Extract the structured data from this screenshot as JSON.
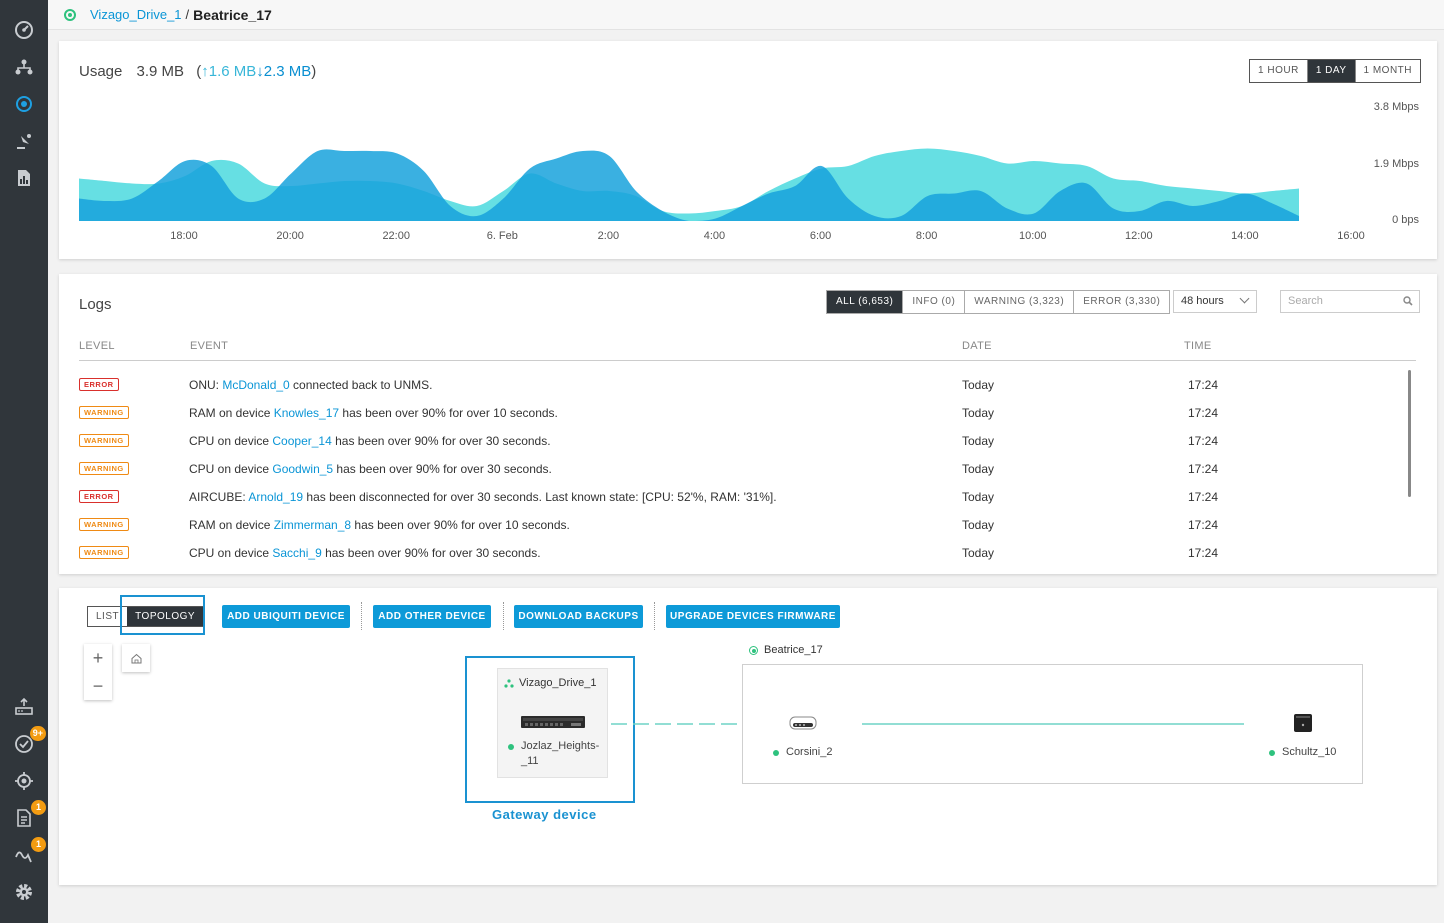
{
  "colors": {
    "accent": "#0a95d6",
    "sidebar": "#30363b",
    "online": "#2ec27e",
    "area_light": "#55dbe0",
    "area_dark": "#17a2dc"
  },
  "sidebar": {
    "icons": [
      "dashboard-icon",
      "sites-icon",
      "devices-icon",
      "wireless-icon",
      "reports-icon",
      "firmware-icon",
      "tasks-icon",
      "discovery-icon",
      "logs-icon",
      "outages-icon",
      "settings-icon"
    ],
    "badges": {
      "tasks": "9+",
      "logs": "1",
      "outages": "1"
    }
  },
  "breadcrumb": {
    "parent": "Vizago_Drive_1",
    "separator": "/",
    "current": "Beatrice_17"
  },
  "usage": {
    "title": "Usage",
    "total": "3.9 MB",
    "open_paren": "(",
    "upload": "1.6 MB",
    "download": "2.3 MB",
    "close_paren": ")",
    "ranges": [
      "1 HOUR",
      "1 DAY",
      "1 MONTH"
    ],
    "active_range": "1 DAY"
  },
  "chart_data": {
    "type": "area",
    "x": [
      "17:00",
      "17:30",
      "18:00",
      "18:30",
      "19:00",
      "19:30",
      "20:00",
      "20:30",
      "21:00",
      "21:30",
      "22:00",
      "22:30",
      "23:00",
      "23:30",
      "00:00",
      "00:30",
      "01:00",
      "01:30",
      "02:00",
      "02:30",
      "03:00",
      "03:30",
      "04:00",
      "04:30",
      "05:00",
      "05:30",
      "06:00",
      "06:30",
      "07:00",
      "07:30",
      "08:00",
      "08:30",
      "09:00",
      "09:30",
      "10:00",
      "10:30",
      "11:00",
      "11:30",
      "12:00",
      "12:30",
      "13:00",
      "13:30",
      "14:00",
      "14:30",
      "15:00",
      "15:30",
      "16:00"
    ],
    "xticks": [
      "18:00",
      "20:00",
      "22:00",
      "6. Feb",
      "2:00",
      "4:00",
      "6:00",
      "8:00",
      "10:00",
      "12:00",
      "14:00",
      "16:00"
    ],
    "yticks": [
      "3.8 Mbps",
      "1.9 Mbps",
      "0 bps"
    ],
    "ylim": [
      0,
      3.8
    ],
    "series": [
      {
        "values": [
          1.7,
          1.6,
          1.5,
          1.5,
          1.8,
          2.4,
          2.3,
          1.5,
          1.4,
          1.5,
          1.6,
          1.6,
          1.5,
          1.2,
          0.8,
          0.6,
          1.2,
          1.9,
          1.5,
          1.2,
          1.2,
          1.0,
          0.4,
          0.3,
          0.4,
          0.6,
          1.2,
          1.7,
          2.1,
          2.2,
          2.6,
          2.8,
          2.9,
          2.8,
          2.6,
          2.3,
          2.4,
          2.3,
          2.2,
          1.7,
          1.6,
          1.4,
          1.3,
          1.2,
          1.1,
          1.2,
          1.3
        ]
      },
      {
        "values": [
          0.9,
          0.8,
          0.9,
          1.6,
          2.4,
          2.2,
          0.9,
          0.9,
          1.9,
          2.8,
          2.8,
          2.8,
          2.7,
          2.0,
          0.6,
          0.2,
          0.9,
          2.1,
          2.5,
          2.8,
          2.6,
          1.2,
          0.4,
          0.0,
          0.1,
          0.6,
          1.1,
          1.4,
          2.2,
          0.9,
          0.2,
          0.2,
          1.0,
          1.1,
          1.2,
          0.5,
          0.3,
          1.2,
          1.5,
          0.5,
          0.4,
          0.8,
          0.6,
          0.8,
          1.1,
          0.7,
          0.2
        ]
      }
    ]
  },
  "logs": {
    "title": "Logs",
    "filters": [
      "ALL (6,653)",
      "INFO (0)",
      "WARNING (3,323)",
      "ERROR (3,330)"
    ],
    "active_filter": "ALL (6,653)",
    "period": "48 hours",
    "search_placeholder": "Search",
    "columns": {
      "level": "LEVEL",
      "event": "EVENT",
      "date": "DATE",
      "time": "TIME"
    },
    "rows": [
      {
        "level": "ERROR",
        "pre": "ONU: ",
        "link": "McDonald_0",
        "post": " connected back to UNMS.",
        "date": "Today",
        "time": "17:24"
      },
      {
        "level": "WARNING",
        "pre": "RAM on device ",
        "link": "Knowles_17",
        "post": " has been over 90% for over 10 seconds.",
        "date": "Today",
        "time": "17:24"
      },
      {
        "level": "WARNING",
        "pre": "CPU on device ",
        "link": "Cooper_14",
        "post": " has been over 90% for over 30 seconds.",
        "date": "Today",
        "time": "17:24"
      },
      {
        "level": "WARNING",
        "pre": "CPU on device ",
        "link": "Goodwin_5",
        "post": " has been over 90% for over 30 seconds.",
        "date": "Today",
        "time": "17:24"
      },
      {
        "level": "ERROR",
        "pre": "AIRCUBE: ",
        "link": "Arnold_19",
        "post": " has been disconnected for over 30 seconds. Last known state: [CPU: 52'%, RAM: '31%].",
        "date": "Today",
        "time": "17:24"
      },
      {
        "level": "WARNING",
        "pre": "RAM on device ",
        "link": "Zimmerman_8",
        "post": " has been over 90% for over 10 seconds.",
        "date": "Today",
        "time": "17:24"
      },
      {
        "level": "WARNING",
        "pre": "CPU on device ",
        "link": "Sacchi_9",
        "post": " has been over 90% for over 30 seconds.",
        "date": "Today",
        "time": "17:24"
      }
    ]
  },
  "devices": {
    "view_list": "LIST",
    "view_topology": "TOPOLOGY",
    "buttons": [
      "ADD UBIQUITI DEVICE",
      "ADD OTHER DEVICE",
      "DOWNLOAD BACKUPS",
      "UPGRADE DEVICES FIRMWARE"
    ],
    "zoom_in": "+",
    "zoom_out": "−",
    "gateway_site": "Vizago_Drive_1",
    "gateway_device_line1": "Jozlaz_Heights-",
    "gateway_device_line2": "_11",
    "gateway_caption": "Gateway device",
    "remote_site": "Beatrice_17",
    "node_a": "Corsini_2",
    "node_b": "Schultz_10"
  }
}
